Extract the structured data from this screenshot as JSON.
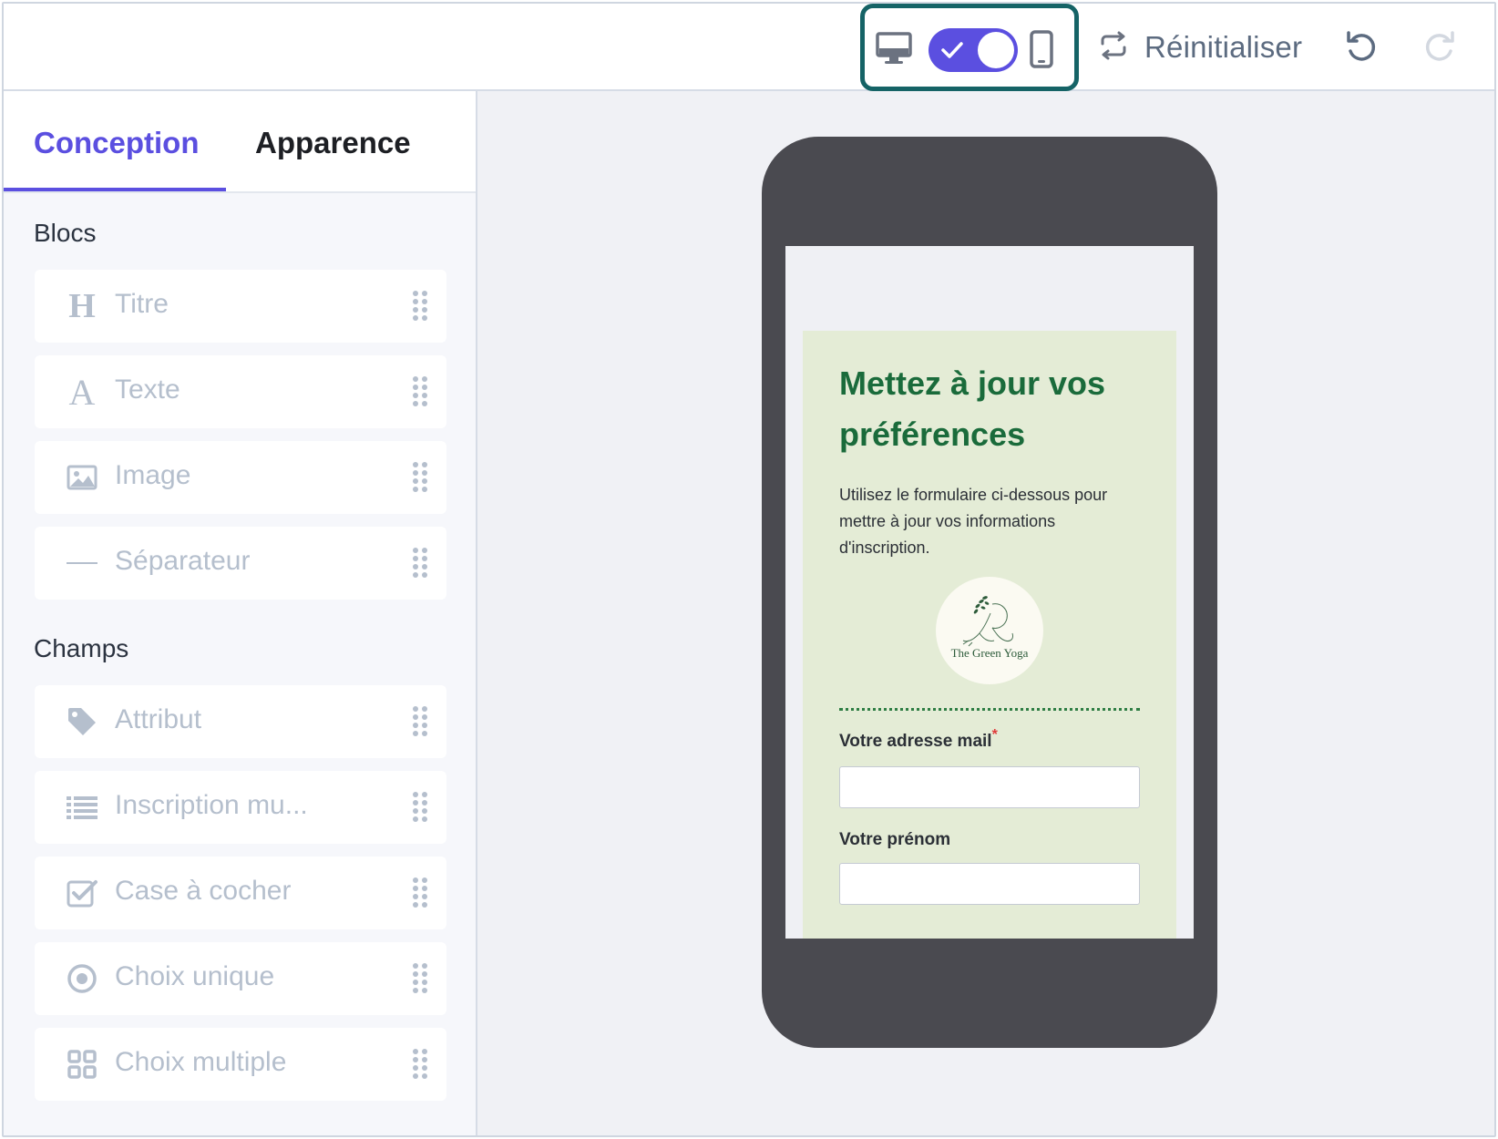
{
  "toolbar": {
    "device_toggle": {
      "desktop_icon": "monitor-icon",
      "mobile_icon": "smartphone-icon",
      "mobile_selected": true,
      "accent_color": "#5b4fe0",
      "highlight_color": "#156366"
    },
    "reset_label": "Réinitialiser",
    "reset_icon": "repeat-icon",
    "undo_icon": "undo-icon",
    "redo_icon": "redo-icon"
  },
  "sidebar": {
    "tabs": [
      {
        "label": "Conception",
        "active": true
      },
      {
        "label": "Apparence",
        "active": false
      }
    ],
    "blocks_title": "Blocs",
    "blocks": [
      {
        "label": "Titre",
        "icon": "heading-icon"
      },
      {
        "label": "Texte",
        "icon": "text-icon"
      },
      {
        "label": "Image",
        "icon": "image-icon"
      },
      {
        "label": "Séparateur",
        "icon": "divider-icon"
      }
    ],
    "fields_title": "Champs",
    "fields": [
      {
        "label": "Attribut",
        "icon": "tag-icon"
      },
      {
        "label": "Inscription mu...",
        "icon": "list-icon"
      },
      {
        "label": "Case à cocher",
        "icon": "checkbox-icon"
      },
      {
        "label": "Choix unique",
        "icon": "radio-icon"
      },
      {
        "label": "Choix multiple",
        "icon": "grid-icon"
      }
    ]
  },
  "preview": {
    "title": "Mettez à jour vos préférences",
    "description": "Utilisez le formulaire ci-dessous pour mettre à jour vos informations d'inscription.",
    "logo_text": "The Green Yoga",
    "email_label": "Votre adresse mail",
    "email_required": "*",
    "firstname_label": "Votre prénom",
    "card_color": "#e4ecd6",
    "title_color": "#1a6b3b"
  }
}
